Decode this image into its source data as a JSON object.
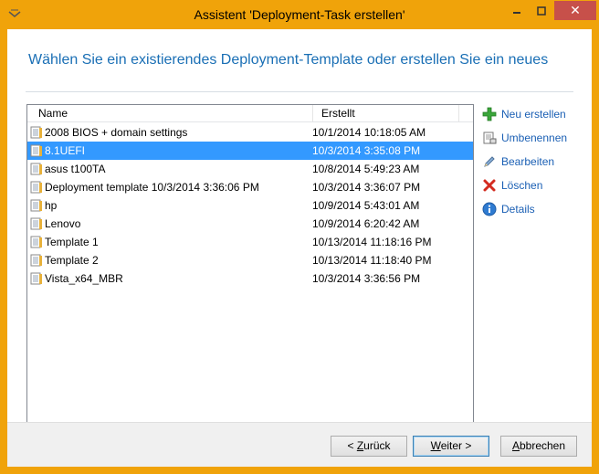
{
  "window": {
    "title": "Assistent 'Deployment-Task erstellen'",
    "close_glyph": "✕"
  },
  "heading": "Wählen Sie ein existierendes Deployment-Template oder erstellen Sie ein neues",
  "list": {
    "columns": [
      "Name",
      "Erstellt"
    ],
    "rows": [
      {
        "name": "2008 BIOS + domain settings",
        "created": "10/1/2014 10:18:05 AM"
      },
      {
        "name": "8.1UEFI",
        "created": "10/3/2014 3:35:08 PM",
        "selected": true
      },
      {
        "name": "asus t100TA",
        "created": "10/8/2014 5:49:23 AM"
      },
      {
        "name": "Deployment template 10/3/2014 3:36:06 PM",
        "created": "10/3/2014 3:36:07 PM"
      },
      {
        "name": "hp",
        "created": "10/9/2014 5:43:01 AM"
      },
      {
        "name": "Lenovo",
        "created": "10/9/2014 6:20:42 AM"
      },
      {
        "name": "Template 1",
        "created": "10/13/2014 11:18:16 PM"
      },
      {
        "name": "Template 2",
        "created": "10/13/2014 11:18:40 PM"
      },
      {
        "name": "Vista_x64_MBR",
        "created": "10/3/2014 3:36:56 PM"
      }
    ]
  },
  "actions": [
    {
      "label": "Neu erstellen",
      "icon": "plus-icon"
    },
    {
      "label": "Umbenennen",
      "icon": "rename-icon"
    },
    {
      "label": "Bearbeiten",
      "icon": "pencil-icon"
    },
    {
      "label": "Löschen",
      "icon": "delete-icon"
    },
    {
      "label": "Details",
      "icon": "info-icon"
    }
  ],
  "buttons": {
    "back": {
      "pre": "< ",
      "u": "Z",
      "post": "urück"
    },
    "next": {
      "pre": "",
      "u": "W",
      "post": "eiter >"
    },
    "cancel": {
      "pre": "",
      "u": "A",
      "post": "bbrechen"
    }
  },
  "colors": {
    "titlebar": "#f0a30a",
    "heading": "#1a6fb5",
    "selection": "#3399ff",
    "link": "#1a5fb4"
  }
}
